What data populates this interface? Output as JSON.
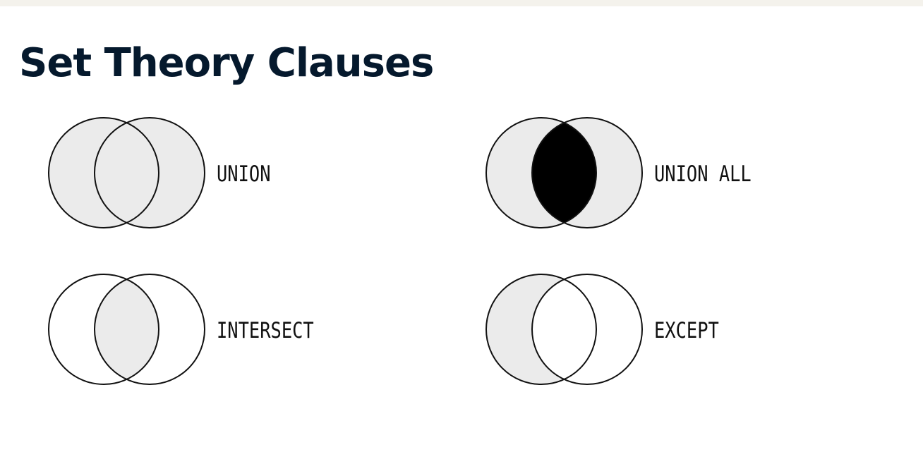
{
  "slide": {
    "title": "Set Theory Clauses"
  },
  "diagrams": [
    {
      "id": "union",
      "label": "UNION",
      "left_fill": "#ebebeb",
      "right_fill": "#ebebeb",
      "overlap_fill": "#ebebeb"
    },
    {
      "id": "union-all",
      "label": "UNION ALL",
      "left_fill": "#ebebeb",
      "right_fill": "#ebebeb",
      "overlap_fill": "#000000"
    },
    {
      "id": "intersect",
      "label": "INTERSECT",
      "left_fill": "#ffffff",
      "right_fill": "#ffffff",
      "overlap_fill": "#ebebeb"
    },
    {
      "id": "except",
      "label": "EXCEPT",
      "left_fill": "#ebebeb",
      "right_fill": "#ffffff",
      "overlap_fill": "#ffffff"
    }
  ],
  "colors": {
    "title": "#05192d",
    "stroke": "#111111",
    "top_bar": "#f4f2ec"
  }
}
